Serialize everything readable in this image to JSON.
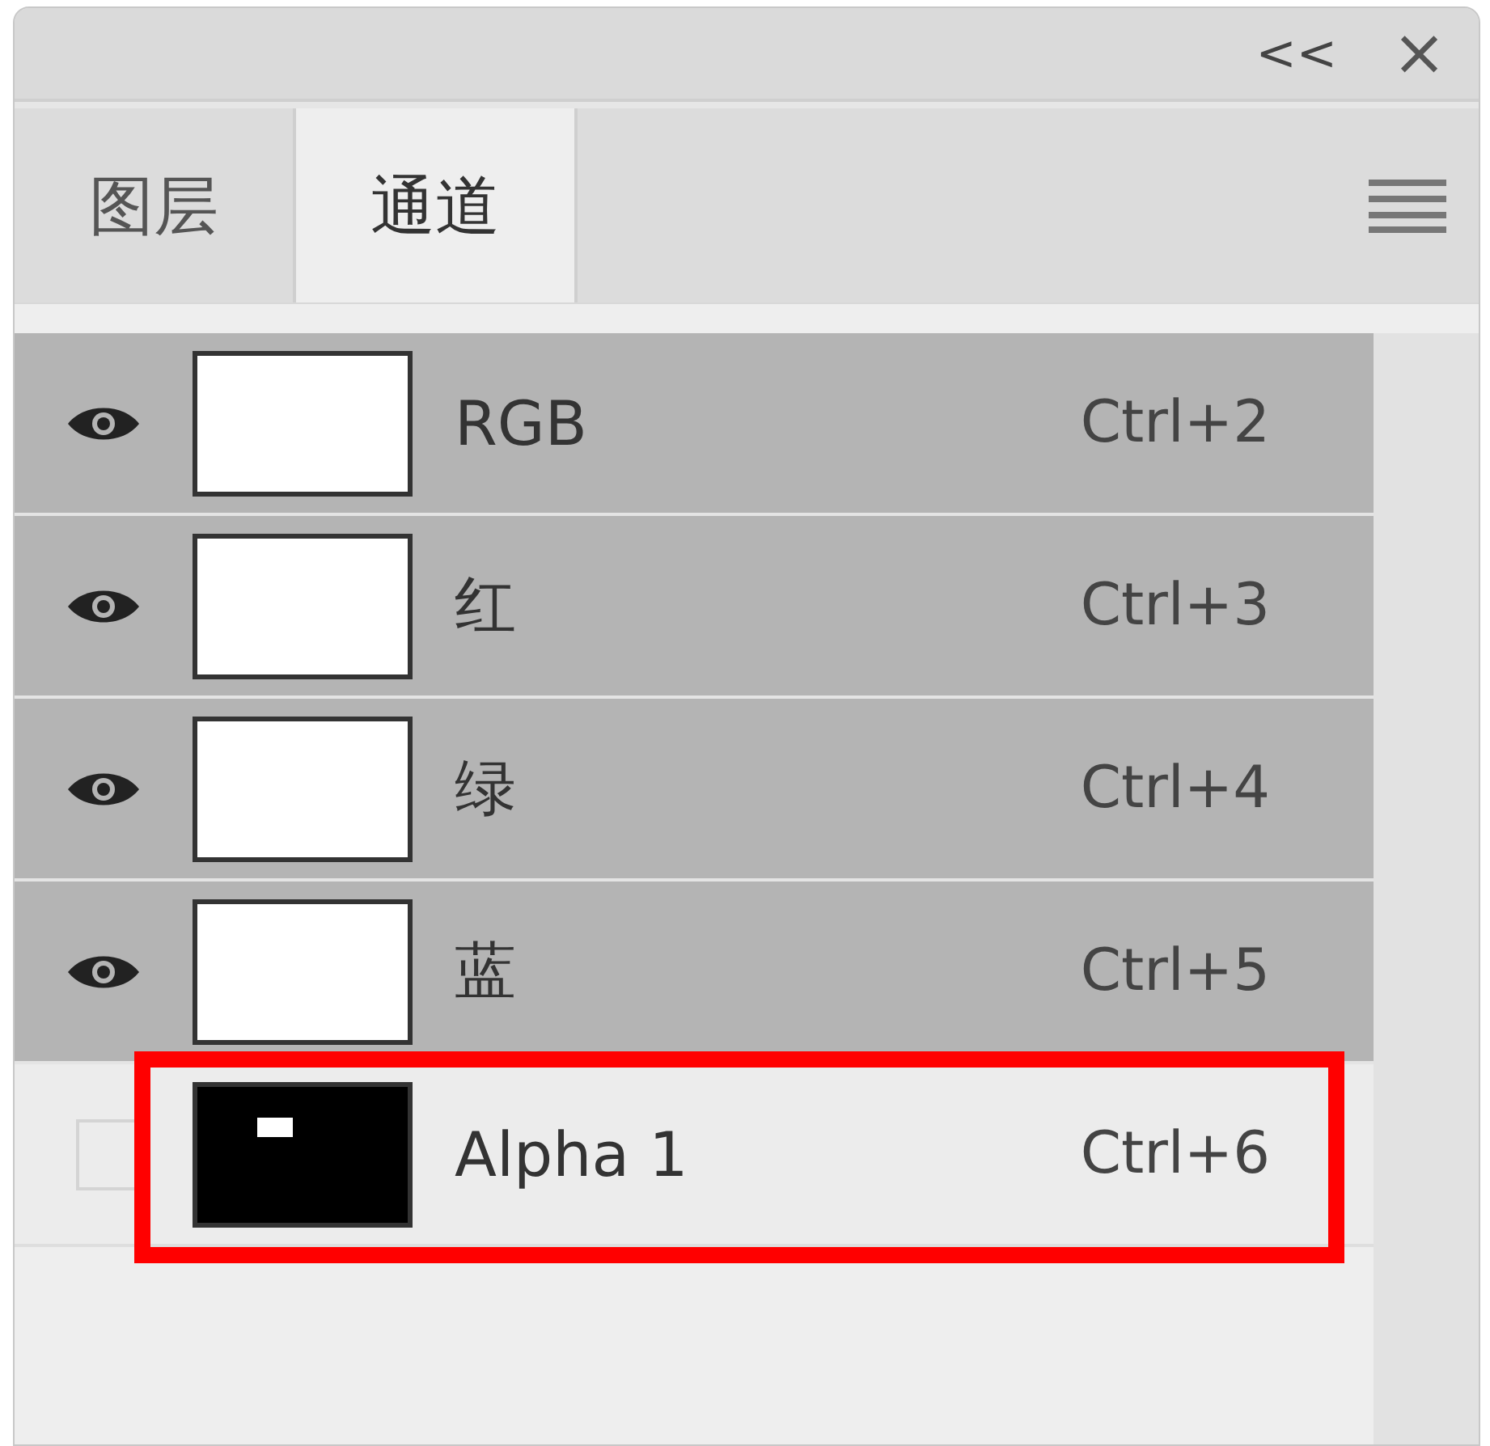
{
  "panel": {
    "collapse_label": "<<",
    "close_label": "×"
  },
  "tabs": [
    {
      "label": "图层",
      "selected": false
    },
    {
      "label": "通道",
      "selected": true
    }
  ],
  "channels": [
    {
      "name": "RGB",
      "shortcut": "Ctrl+2",
      "visible": true,
      "selected": true,
      "kind": "color",
      "highlighted": false
    },
    {
      "name": "红",
      "shortcut": "Ctrl+3",
      "visible": true,
      "selected": true,
      "kind": "color",
      "highlighted": false
    },
    {
      "name": "绿",
      "shortcut": "Ctrl+4",
      "visible": true,
      "selected": true,
      "kind": "color",
      "highlighted": false
    },
    {
      "name": "蓝",
      "shortcut": "Ctrl+5",
      "visible": true,
      "selected": true,
      "kind": "color",
      "highlighted": false
    },
    {
      "name": "Alpha 1",
      "shortcut": "Ctrl+6",
      "visible": false,
      "selected": false,
      "kind": "alpha",
      "highlighted": true
    }
  ]
}
